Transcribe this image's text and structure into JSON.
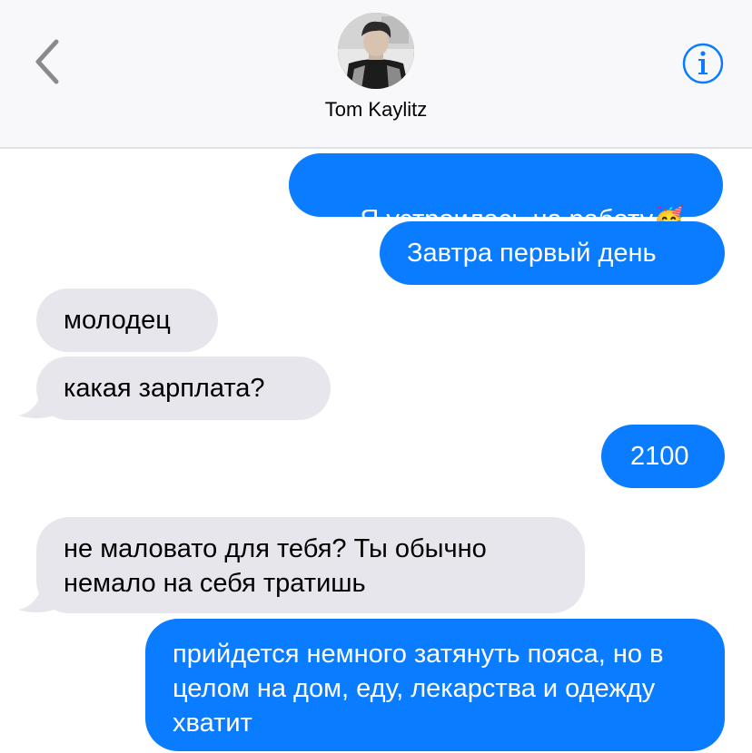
{
  "header": {
    "back_icon": "chevron-left-icon",
    "contact_name": "Tom Kaylitz",
    "info_icon": "info-icon",
    "accent_color": "#0a7cff"
  },
  "messages": [
    {
      "direction": "outgoing",
      "text": "Я устроилась на работу",
      "emoji": "🥳"
    },
    {
      "direction": "outgoing",
      "text": "Завтра первый день"
    },
    {
      "direction": "incoming",
      "text": "молодец"
    },
    {
      "direction": "incoming",
      "text": "какая зарплата?"
    },
    {
      "direction": "outgoing",
      "text": "2100"
    },
    {
      "direction": "incoming",
      "text": "не маловато для тебя? Ты обычно немало на себя тратишь"
    },
    {
      "direction": "outgoing",
      "text": "прийдется немного затянуть пояса, но в целом на дом, еду, лекарства и одежду хватит"
    }
  ],
  "colors": {
    "outgoing_bubble": "#0a7cff",
    "incoming_bubble": "#e8e6ed",
    "header_bg": "#f8f8fa"
  }
}
